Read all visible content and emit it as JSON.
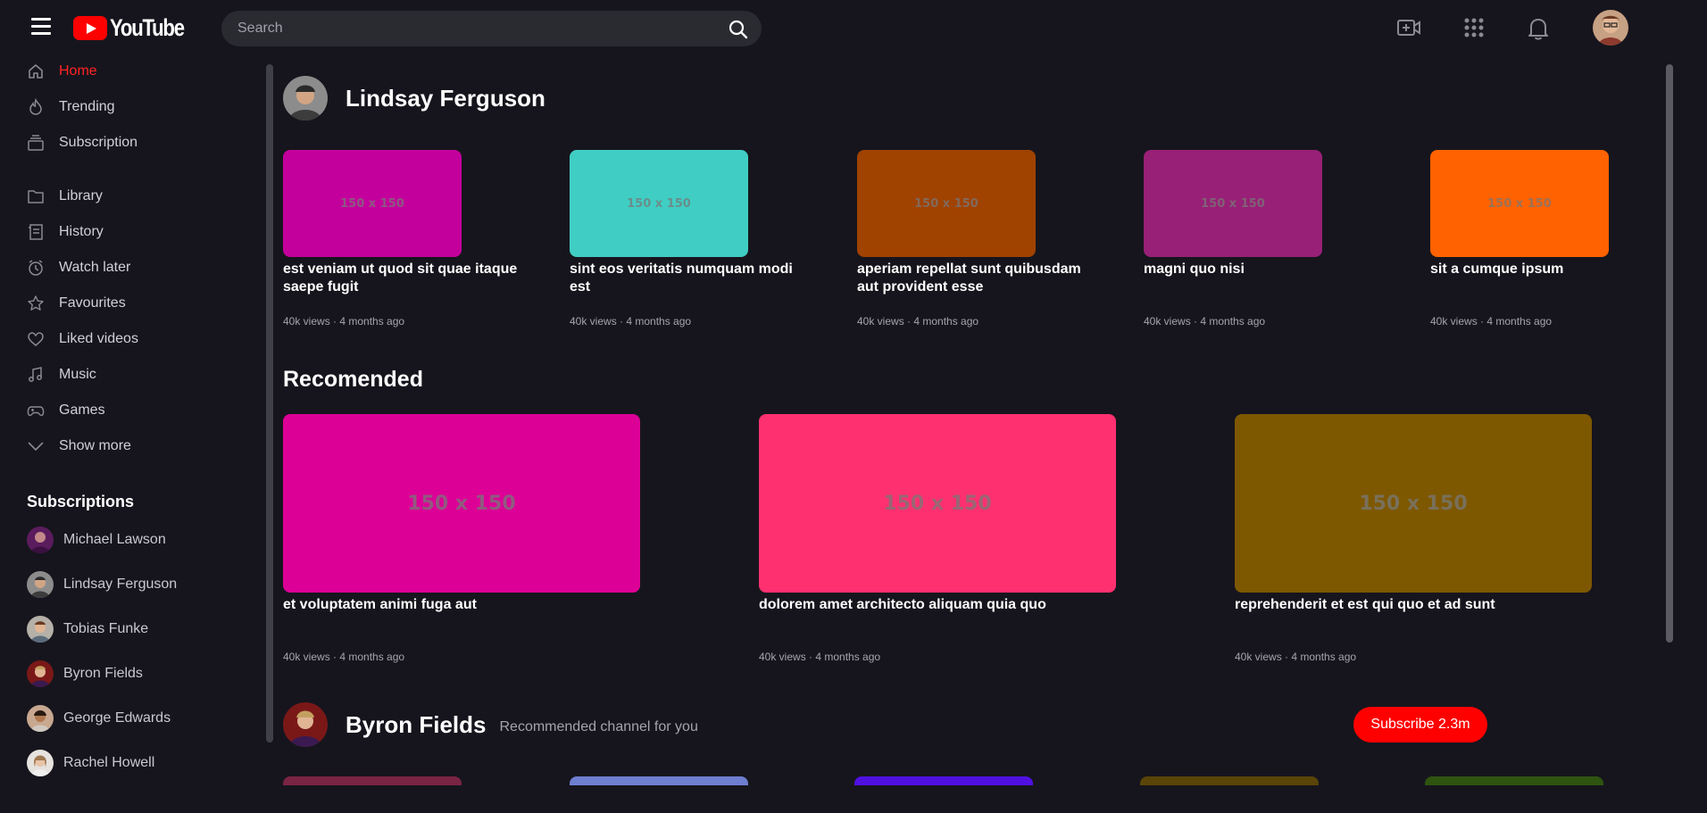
{
  "header": {
    "logo_text": "YouTube",
    "search_placeholder": "Search",
    "icons": [
      "menu-icon",
      "video-camera-icon",
      "apps-grid-icon",
      "bell-icon",
      "search-icon"
    ]
  },
  "sidebar": {
    "nav": [
      {
        "label": "Home",
        "icon": "home-icon",
        "active": true
      },
      {
        "label": "Trending",
        "icon": "flame-icon"
      },
      {
        "label": "Subscription",
        "icon": "subscription-icon"
      },
      {
        "label": "Library",
        "icon": "folder-icon"
      },
      {
        "label": "History",
        "icon": "history-icon"
      },
      {
        "label": "Watch later",
        "icon": "clock-icon"
      },
      {
        "label": "Favourites",
        "icon": "star-icon"
      },
      {
        "label": "Liked videos",
        "icon": "heart-icon"
      },
      {
        "label": "Music",
        "icon": "music-icon"
      },
      {
        "label": "Games",
        "icon": "gamepad-icon"
      },
      {
        "label": "Show more",
        "icon": "chevron-down-icon"
      }
    ],
    "subscriptions_title": "Subscriptions",
    "subscriptions": [
      {
        "name": "Michael Lawson"
      },
      {
        "name": "Lindsay Ferguson"
      },
      {
        "name": "Tobias Funke"
      },
      {
        "name": "Byron Fields"
      },
      {
        "name": "George Edwards"
      },
      {
        "name": "Rachel Howell"
      }
    ]
  },
  "main": {
    "channel1": {
      "name": "Lindsay Ferguson",
      "videos": [
        {
          "thumb_text": "150 x 150",
          "color": "#c4009c",
          "title": "est veniam ut quod sit quae itaque saepe fugit",
          "meta": "40k views · 4 months ago"
        },
        {
          "thumb_text": "150 x 150",
          "color": "#40cec4",
          "title": "sint eos veritatis numquam modi est",
          "meta": "40k views · 4 months ago"
        },
        {
          "thumb_text": "150 x 150",
          "color": "#a04200",
          "title": "aperiam repellat sunt quibusdam aut provident esse",
          "meta": "40k views · 4 months ago"
        },
        {
          "thumb_text": "150 x 150",
          "color": "#982076",
          "title": "magni quo nisi",
          "meta": "40k views · 4 months ago"
        },
        {
          "thumb_text": "150 x 150",
          "color": "#ff6200",
          "title": "sit a cumque ipsum",
          "meta": "40k views · 4 months ago"
        }
      ]
    },
    "recommended": {
      "title": "Recomended",
      "videos": [
        {
          "thumb_text": "150 x 150",
          "color": "#dc0096",
          "title": "et voluptatem animi fuga aut",
          "meta": "40k views · 4 months ago"
        },
        {
          "thumb_text": "150 x 150",
          "color": "#ff3070",
          "title": "dolorem amet architecto aliquam quia quo",
          "meta": "40k views · 4 months ago"
        },
        {
          "thumb_text": "150 x 150",
          "color": "#7e5800",
          "title": "reprehenderit et est qui quo et ad sunt",
          "meta": "40k views · 4 months ago"
        }
      ]
    },
    "channel2": {
      "name": "Byron Fields",
      "subtitle": "Recommended channel for you",
      "subscribe_label": "Subscribe 2.3m",
      "peek_colors": [
        "#7a2444",
        "#6e7ed0",
        "#5010e0",
        "#5a4408",
        "#2e5410"
      ]
    }
  },
  "colors": {
    "background": "#16151d",
    "accent": "#ff0000",
    "active_nav": "#ff2424"
  }
}
